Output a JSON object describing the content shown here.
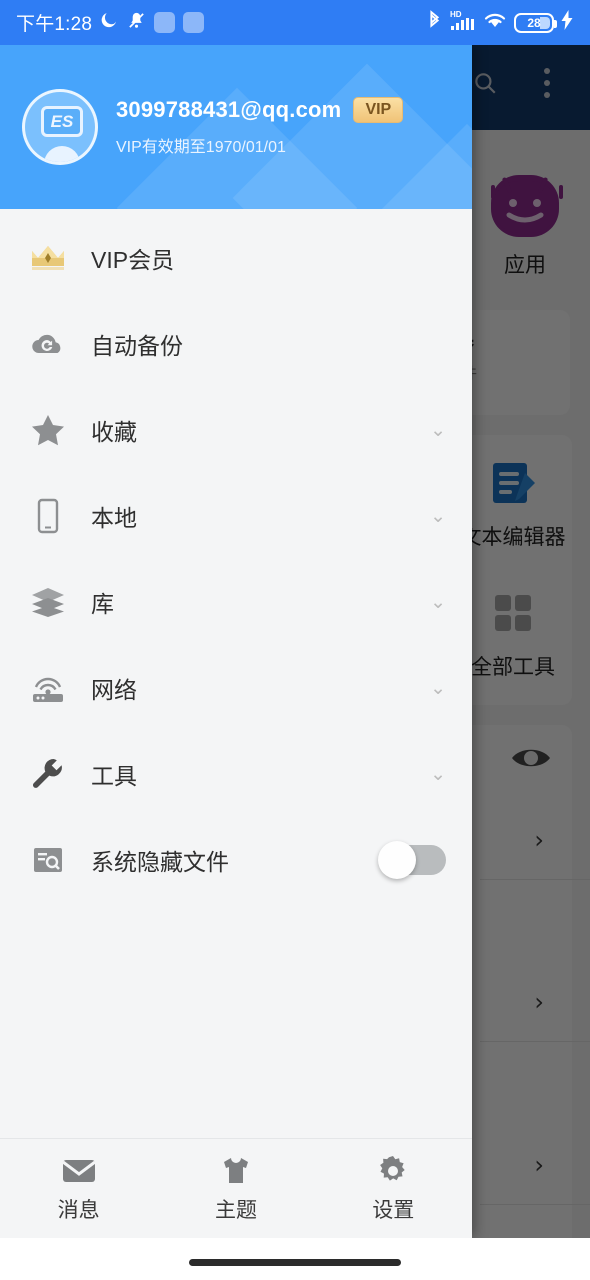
{
  "status_bar": {
    "time": "下午1:28",
    "icons_left": [
      "moon-icon",
      "mute-bell-icon",
      "app-badge-icon",
      "app-badge-icon-2"
    ],
    "icons_right": [
      "bluetooth-icon",
      "hd-signal-icon",
      "wifi-icon"
    ],
    "battery_percent": "28",
    "charging": true,
    "background_color": "#2f7df4"
  },
  "drawer": {
    "header": {
      "avatar_label": "ES",
      "account_email": "3099788431@qq.com",
      "vip_badge": "VIP",
      "vip_expiry": "VIP有效期至1970/01/01",
      "background_color": "#47a4fb"
    },
    "menu_items": [
      {
        "icon": "crown-icon",
        "label": "VIP会员",
        "has_chevron": false,
        "has_toggle": false
      },
      {
        "icon": "cloud-sync-icon",
        "label": "自动备份",
        "has_chevron": false,
        "has_toggle": false
      },
      {
        "icon": "star-icon",
        "label": "收藏",
        "has_chevron": true,
        "has_toggle": false
      },
      {
        "icon": "phone-icon",
        "label": "本地",
        "has_chevron": true,
        "has_toggle": false
      },
      {
        "icon": "layers-icon",
        "label": "库",
        "has_chevron": true,
        "has_toggle": false
      },
      {
        "icon": "router-icon",
        "label": "网络",
        "has_chevron": true,
        "has_toggle": false
      },
      {
        "icon": "wrench-icon",
        "label": "工具",
        "has_chevron": true,
        "has_toggle": false
      },
      {
        "icon": "hidden-file-search-icon",
        "label": "系统隐藏文件",
        "has_chevron": false,
        "has_toggle": true,
        "toggle_on": false
      }
    ],
    "chevron_glyph": "⌄",
    "bottom_nav": [
      {
        "icon": "envelope-icon",
        "label": "消息"
      },
      {
        "icon": "tshirt-icon",
        "label": "主题"
      },
      {
        "icon": "gear-icon",
        "label": "设置"
      }
    ]
  },
  "background_app": {
    "appbar": {
      "search_icon": "search-icon",
      "overflow_icon": "kebab-menu-icon",
      "background_color": "#133a6b"
    },
    "shortcut": {
      "icon": "android-apps-icon",
      "label": "应用"
    },
    "card": {
      "title": "析器",
      "subtitle": "理文件"
    },
    "tools": [
      {
        "icon": "text-editor-icon",
        "label": "文本编辑器"
      },
      {
        "icon": "grid-icon",
        "label": "全部工具"
      }
    ],
    "eye_icon": "eye-icon",
    "row_chevron": "›",
    "rows_count": 3
  },
  "gesture_bar": {
    "pill_color": "#2b2b2b"
  }
}
